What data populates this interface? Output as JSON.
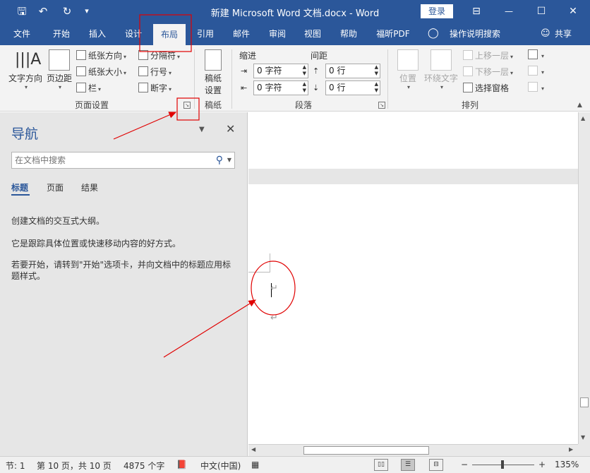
{
  "titlebar": {
    "title": "新建 Microsoft Word 文档.docx  -  Word",
    "login": "登录",
    "save_icon": "save-icon",
    "undo_icon": "undo-icon",
    "redo_icon": "redo-icon",
    "customize_icon": "customize-qat-icon",
    "glyphs": {
      "save": "🖫",
      "undo": "↶",
      "redo": "↻",
      "customize": "▾",
      "restore_ribbon": "⊟",
      "minimize": "—",
      "maximize": "☐",
      "close": "✕"
    }
  },
  "tabs": [
    {
      "label": "文件"
    },
    {
      "label": "开始"
    },
    {
      "label": "插入"
    },
    {
      "label": "设计"
    },
    {
      "label": "布局"
    },
    {
      "label": "引用"
    },
    {
      "label": "邮件"
    },
    {
      "label": "审阅"
    },
    {
      "label": "视图"
    },
    {
      "label": "帮助"
    },
    {
      "label": "福昕PDF"
    },
    {
      "label": "操作说明搜索"
    }
  ],
  "share": "共享",
  "active_tab": "布局",
  "ribbon": {
    "page_setup": {
      "text_direction": "文字方向",
      "margins": "页边距",
      "orientation": "纸张方向",
      "size": "纸张大小",
      "columns": "栏",
      "breaks": "分隔符",
      "line_numbers": "行号",
      "hyphenation": "断字",
      "group_label": "页面设置"
    },
    "manuscript": {
      "button": "稿纸设置",
      "line1": "稿纸",
      "line2": "设置",
      "group_label": "稿纸"
    },
    "paragraph": {
      "indent_label": "缩进",
      "spacing_label": "间距",
      "indent_left": "0 字符",
      "indent_right": "0 字符",
      "spacing_before": "0 行",
      "spacing_after": "0 行",
      "group_label": "段落"
    },
    "arrange": {
      "position": "位置",
      "wrap_text": "环绕文字",
      "bring_forward": "上移一层",
      "send_backward": "下移一层",
      "selection_pane": "选择窗格",
      "group_label": "排列"
    }
  },
  "nav": {
    "title": "导航",
    "search_placeholder": "在文档中搜索",
    "tabs": [
      {
        "label": "标题"
      },
      {
        "label": "页面"
      },
      {
        "label": "结果"
      }
    ],
    "para1": "创建文档的交互式大纲。",
    "para2": "它是跟踪具体位置或快速移动内容的好方式。",
    "para3": "若要开始，请转到\"开始\"选项卡，并向文档中的标题应用标题样式。"
  },
  "document": {
    "para_mark": "↵"
  },
  "status": {
    "section": "节: 1",
    "page": "第 10 页，共 10 页",
    "words": "4875 个字",
    "language": "中文(中国)",
    "zoom": "135%",
    "zoom_minus": "−",
    "zoom_plus": "+"
  },
  "colors": {
    "accent": "#2b579a",
    "annotation": "#e00000"
  }
}
